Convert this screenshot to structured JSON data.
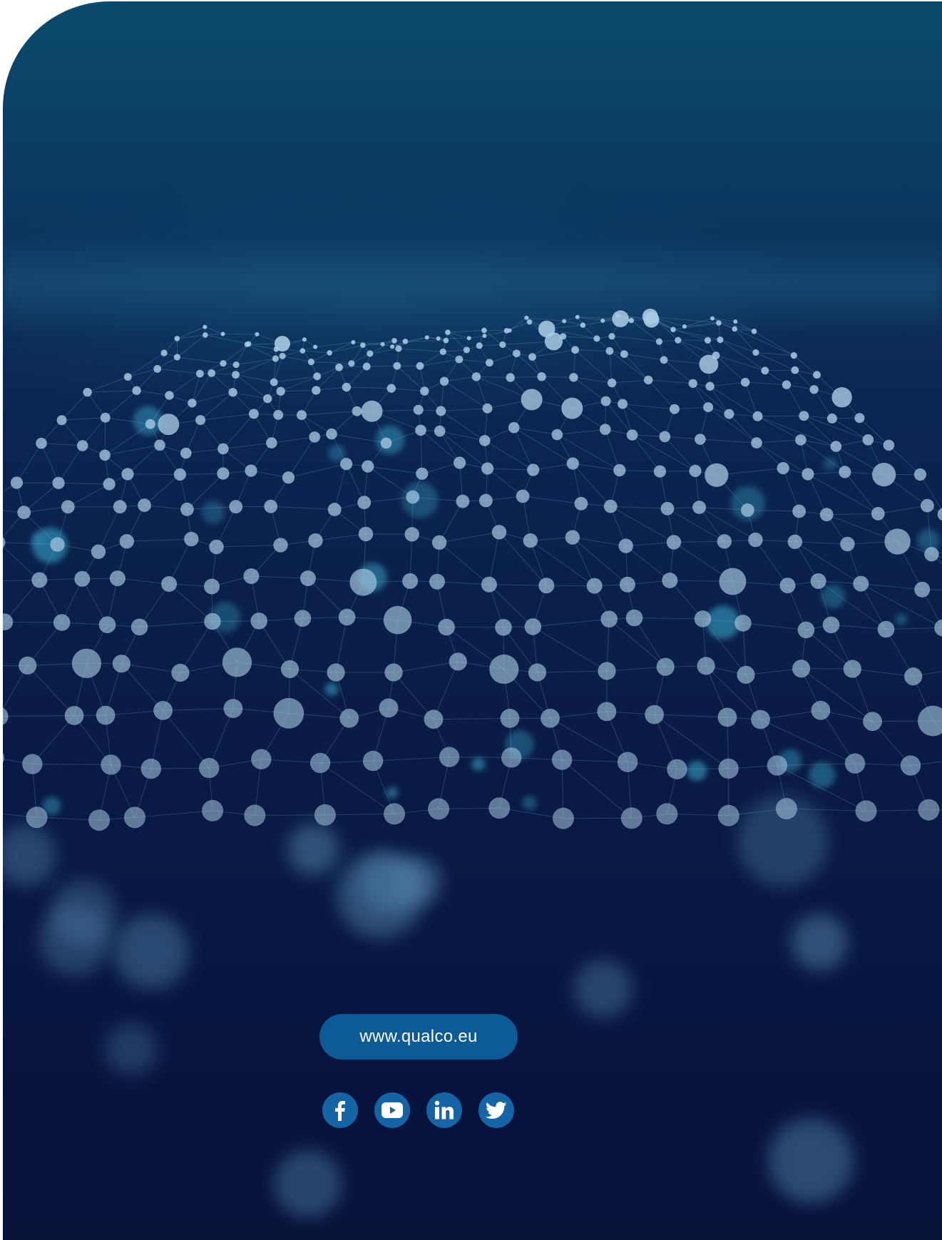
{
  "website": {
    "url_label": "www.qualco.eu"
  },
  "social_links": [
    {
      "name": "facebook",
      "icon": "facebook-icon"
    },
    {
      "name": "youtube",
      "icon": "youtube-icon"
    },
    {
      "name": "linkedin",
      "icon": "linkedin-icon"
    },
    {
      "name": "twitter",
      "icon": "twitter-icon"
    }
  ],
  "colors": {
    "background_top": "#0a4a6c",
    "background_bottom": "#061238",
    "accent": "#0d5b96",
    "icon_circle": "#1564a6",
    "node": "#a9cbe2"
  }
}
